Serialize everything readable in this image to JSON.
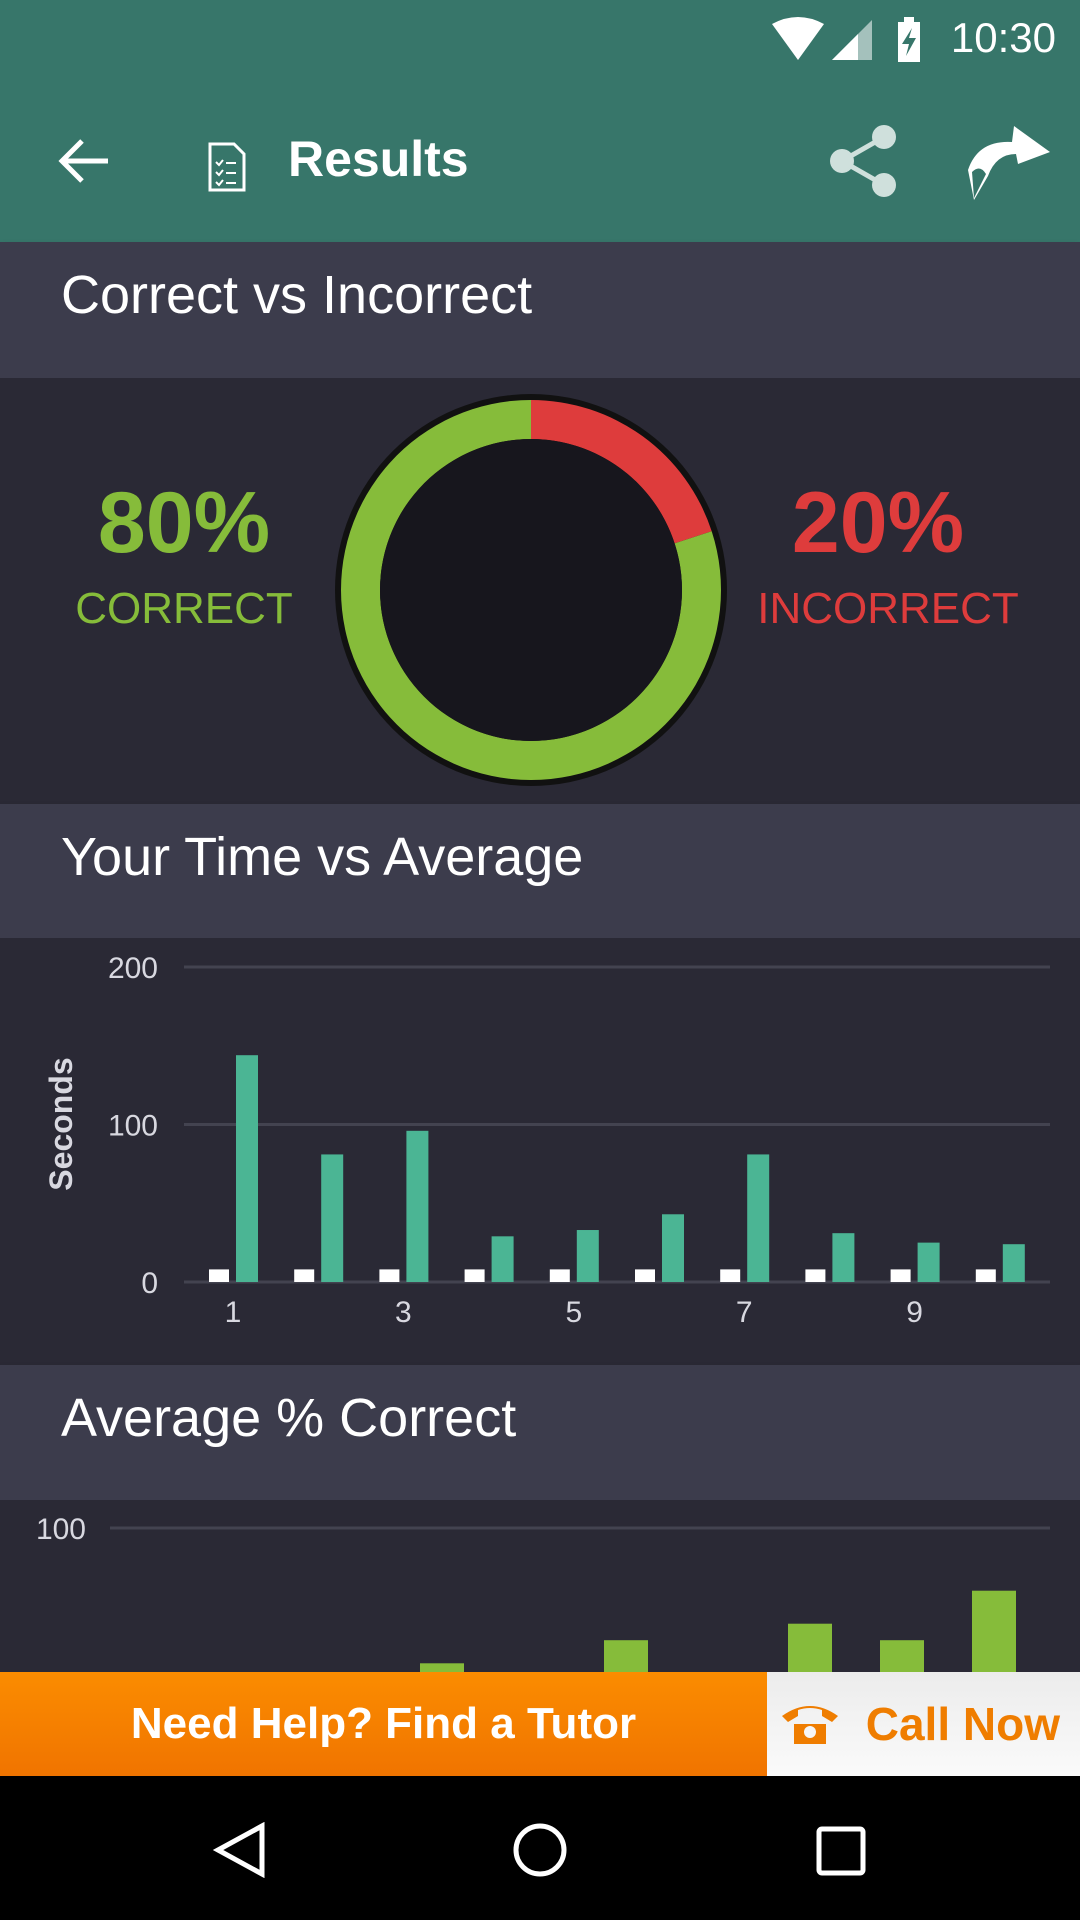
{
  "status_bar": {
    "time": "10:30",
    "icons": [
      "wifi-icon",
      "signal-icon",
      "battery-charging-icon"
    ]
  },
  "toolbar": {
    "title": "Results",
    "icons": [
      "back-arrow-icon",
      "document-checklist-icon",
      "share-icon",
      "forward-icon"
    ]
  },
  "colors": {
    "toolbar": "#37766a",
    "correct": "#86bc3a",
    "incorrect": "#de3c3c",
    "your_time": "#4bb594",
    "average": "#ffffff",
    "accent": "#fb8c00"
  },
  "section1": {
    "title": "Correct vs Incorrect",
    "correct_pct": "80%",
    "correct_label": "CORRECT",
    "incorrect_pct": "20%",
    "incorrect_label": "INCORRECT"
  },
  "section2": {
    "title": "Your Time vs Average"
  },
  "section3": {
    "title": "Average % Correct"
  },
  "banner": {
    "tutor_label": "Need Help? Find a Tutor",
    "call_label": "Call Now"
  },
  "chart_data": [
    {
      "type": "pie",
      "variant": "donut",
      "slices": [
        {
          "label": "CORRECT",
          "value": 80
        },
        {
          "label": "INCORRECT",
          "value": 20
        }
      ]
    },
    {
      "type": "bar",
      "ylabel": "Seconds",
      "ylim": [
        0,
        200
      ],
      "yticks": [
        "0",
        "100",
        "200"
      ],
      "categories": [
        1,
        2,
        3,
        4,
        5,
        6,
        7,
        8,
        9,
        10
      ],
      "xtick_labels": [
        "1",
        "3",
        "5",
        "7",
        "9"
      ],
      "grid": true,
      "series": [
        {
          "color": "#ffffff",
          "values": [
            8,
            8,
            8,
            8,
            8,
            8,
            8,
            8,
            8,
            8
          ]
        },
        {
          "color": "#4bb594",
          "values": [
            144,
            81,
            96,
            29,
            33,
            43,
            81,
            31,
            25,
            24
          ]
        }
      ]
    },
    {
      "type": "bar",
      "yticks": [
        "100"
      ],
      "grid": true,
      "categories": [
        1,
        2,
        3,
        4,
        5,
        6,
        7,
        8,
        9,
        10
      ],
      "series": [
        {
          "color": "#86bc3a",
          "values": [
            null,
            null,
            null,
            59,
            null,
            66,
            null,
            71,
            66,
            81
          ]
        }
      ]
    }
  ]
}
